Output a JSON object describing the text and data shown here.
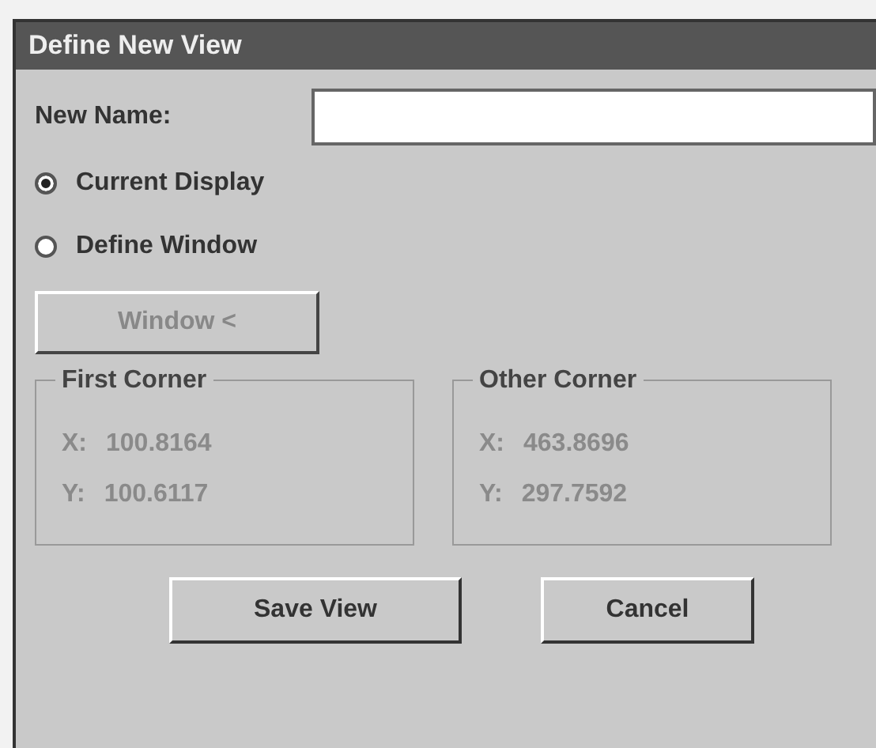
{
  "window": {
    "title": "Define New View"
  },
  "name_field": {
    "label": "New Name:"
  },
  "options": [
    {
      "label": "Current Display",
      "selected": true
    },
    {
      "label": "Define Window",
      "selected": false
    }
  ],
  "window_button": {
    "label": "Window <",
    "disabled": true
  },
  "corners": [
    {
      "title": "First Corner",
      "rows": [
        {
          "axis": "X:",
          "value": "100.8164"
        },
        {
          "axis": "Y:",
          "value": "100.6117"
        }
      ]
    },
    {
      "title": "Other Corner",
      "rows": [
        {
          "axis": "X:",
          "value": "463.8696"
        },
        {
          "axis": "Y:",
          "value": "297.7592"
        }
      ]
    }
  ],
  "buttons": [
    {
      "label": "Save View"
    },
    {
      "label": "Cancel"
    }
  ]
}
